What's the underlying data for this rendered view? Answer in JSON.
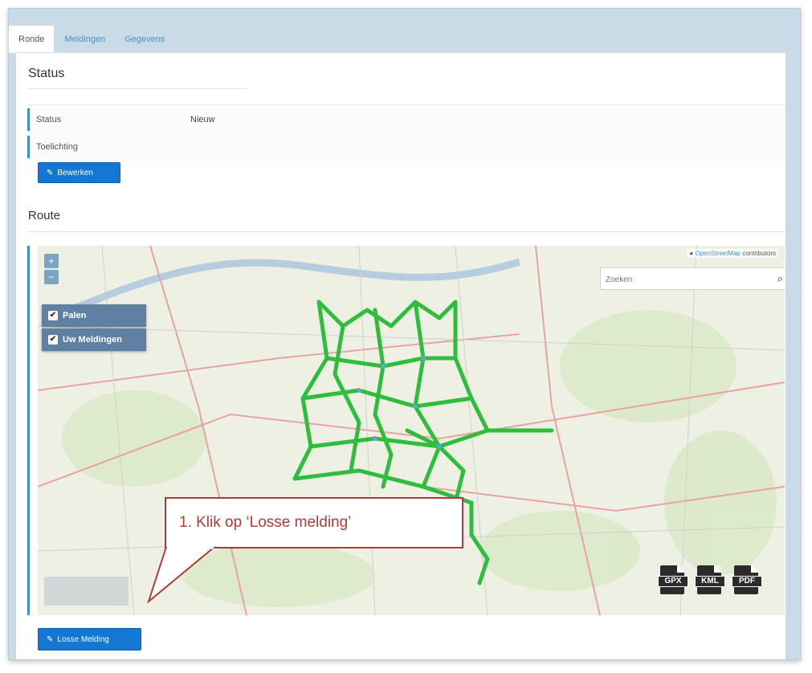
{
  "tabs": [
    {
      "label": "Ronde",
      "active": true
    },
    {
      "label": "Meldingen",
      "active": false
    },
    {
      "label": "Gegevens",
      "active": false
    }
  ],
  "status_section": {
    "title": "Status",
    "rows": [
      {
        "label": "Status",
        "value": "Nieuw"
      },
      {
        "label": "Toelichting",
        "value": ""
      }
    ],
    "edit_button": "Bewerken"
  },
  "route_section": {
    "title": "Route",
    "map": {
      "attribution_link": "OpenStreetMap",
      "attribution_text": "contributors",
      "search_placeholder": "Zoeken",
      "zoom_in": "+",
      "zoom_out": "−",
      "layers": [
        {
          "label": "Palen",
          "checked": true
        },
        {
          "label": "Uw Meldingen",
          "checked": true
        }
      ],
      "downloads": [
        "GPX",
        "KML",
        "PDF"
      ]
    },
    "loose_report_button": "Losse Melding"
  },
  "callout": {
    "text": "1. Klik op ‘Losse melding’",
    "color": "#b03a3a"
  },
  "colors": {
    "accent": "#1477d4",
    "route": "#2ebd3c",
    "tab_link": "#4a90c8"
  }
}
